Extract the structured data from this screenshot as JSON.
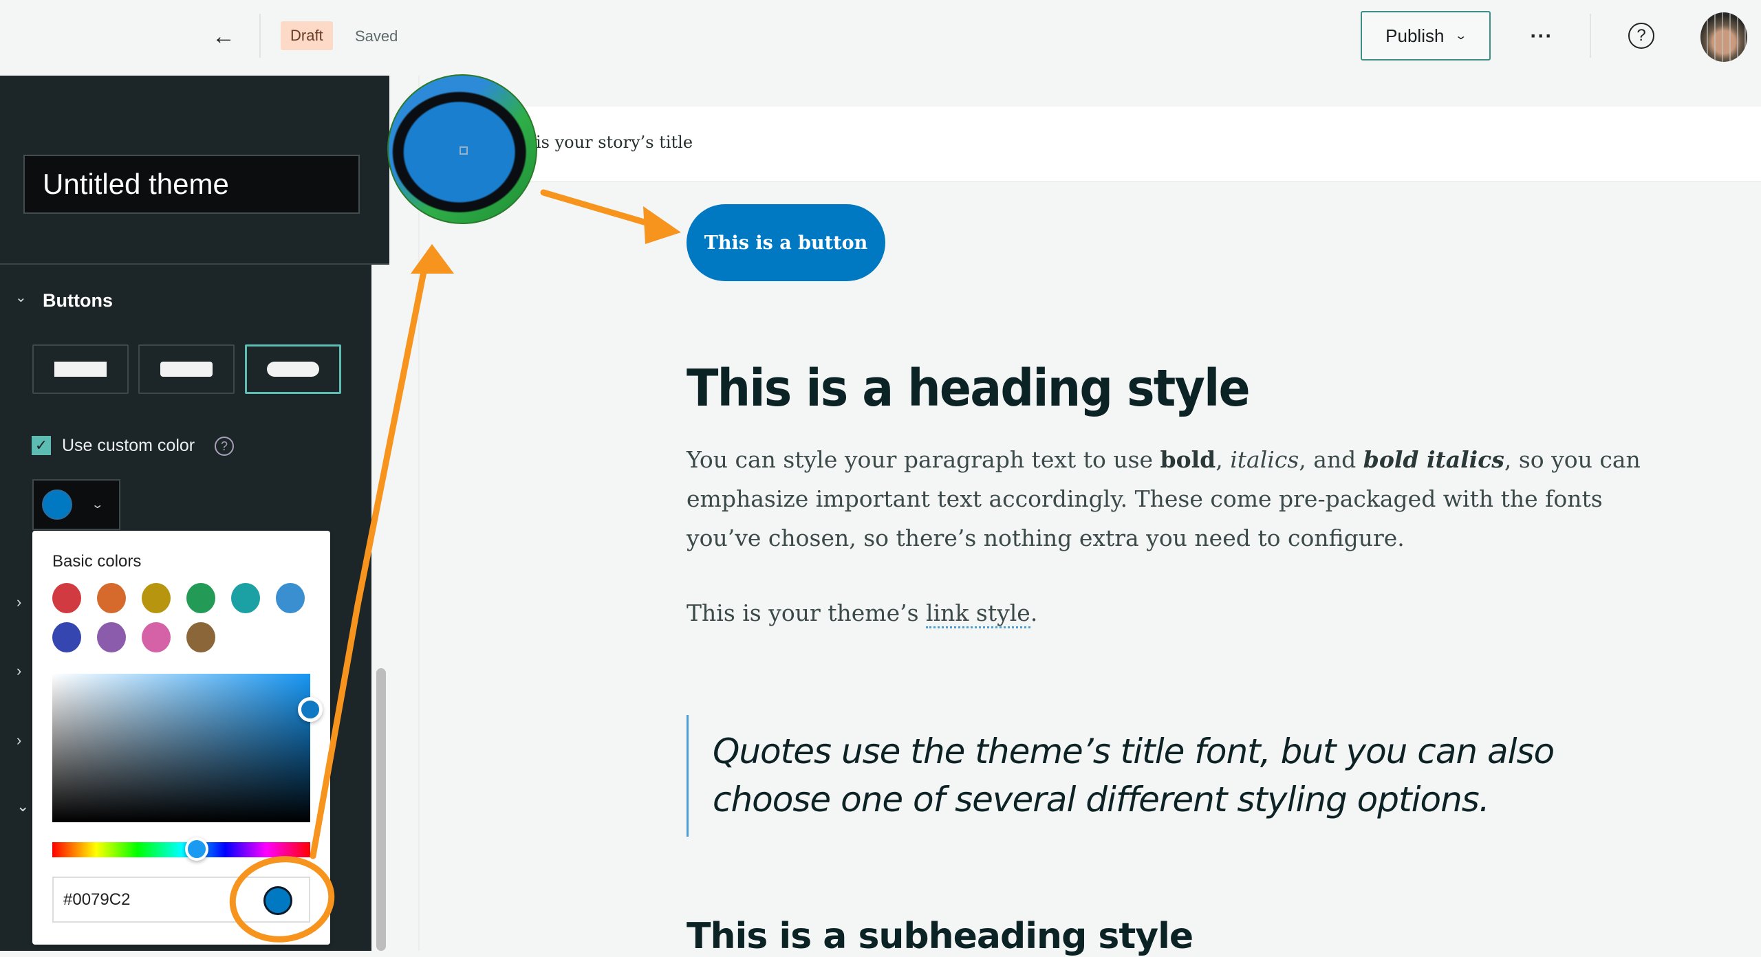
{
  "header": {
    "back_icon": "arrow-left-icon",
    "back_glyph": "←",
    "status_badge": "Draft",
    "save_status": "Saved",
    "publish_label": "Publish",
    "publish_chevron": "⌄",
    "more_glyph": "···",
    "help_glyph": "?"
  },
  "panel": {
    "theme_name": "Untitled theme",
    "section_title": "Buttons",
    "section_chevron": "⌄",
    "button_shapes": [
      {
        "name": "square",
        "selected": false
      },
      {
        "name": "rounded",
        "selected": false
      },
      {
        "name": "pill",
        "selected": true
      }
    ],
    "custom_color_checked": true,
    "custom_color_label": "Use custom color",
    "check_glyph": "✓",
    "help_glyph": "?",
    "swatch_chevron": "⌄",
    "current_color": "#0079C2",
    "collapsed_sections_glyph": "›",
    "expanded_section_glyph": "⌄"
  },
  "color_picker": {
    "basic_label": "Basic colors",
    "basic_colors": [
      "#d03a40",
      "#d56a2c",
      "#b8950e",
      "#239a55",
      "#1ba0a4",
      "#3a8fd0",
      "#3646b0",
      "#8b5cab",
      "#d561a6",
      "#8a6638"
    ],
    "hue_percent": 56,
    "saturation_percent": 100,
    "brightness_percent": 76,
    "hex_value": "#0079C2"
  },
  "canvas": {
    "story_title": "is your story’s title",
    "button_label": "This is a button",
    "button_color": "#0079C2",
    "heading": "This is a heading style",
    "paragraph": {
      "p1": "You can style your paragraph text to use ",
      "bold": "bold",
      "sep1": ", ",
      "italic": "italics",
      "sep2": ", and ",
      "bold_italic": "bold italics",
      "p2": ", so you can emphasize important text accordingly. These come pre-packaged with the fonts you’ve chosen, so there’s nothing extra you need to configure."
    },
    "link_prefix": "This is your theme’s ",
    "link_text": "link style",
    "link_suffix": ".",
    "quote": "Quotes use the theme’s title font, but you can also choose one of several different styling options.",
    "subheading": "This is a subheading style"
  }
}
